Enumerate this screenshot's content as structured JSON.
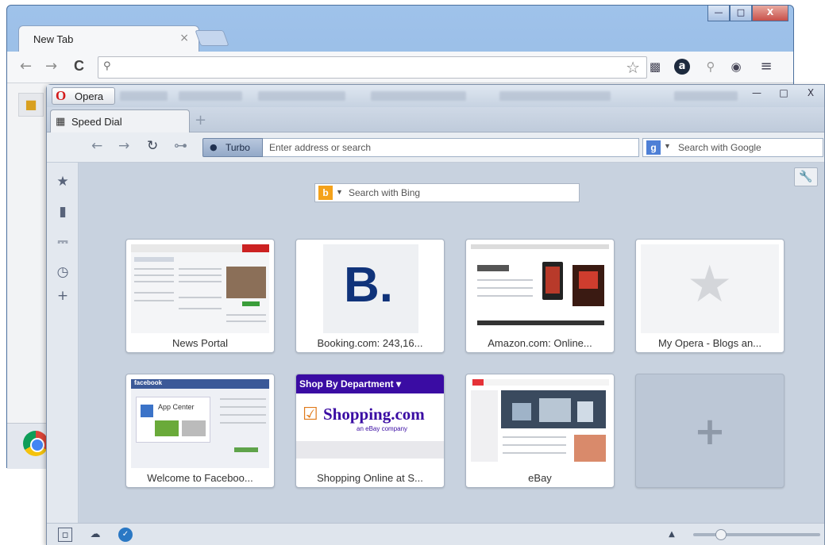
{
  "chrome": {
    "tab_title": "New Tab",
    "tab_close": "×",
    "window_buttons": {
      "minimize": "—",
      "maximize": "□",
      "close": "X"
    },
    "nav": {
      "back": "←",
      "forward": "→",
      "reload": "C"
    },
    "omnibox_placeholder": "",
    "bookmark_star": "☆",
    "extensions": [
      "camera-icon",
      "a-icon",
      "search-icon",
      "eye-icon"
    ],
    "menu_icon": "≡"
  },
  "opera": {
    "menu_label": "Opera",
    "window_buttons": {
      "minimize": "—",
      "maximize": "□",
      "close": "X"
    },
    "tab_title": "Speed Dial",
    "add_tab": "+",
    "turbo_label": "Turbo",
    "address_placeholder": "Enter address or search",
    "search_placeholder": "Search with Google",
    "bing_placeholder": "Search with Bing",
    "sidebar": [
      "bookmarks-star",
      "notes",
      "downloads",
      "history",
      "add-panel"
    ],
    "tiles": [
      {
        "caption": "News Portal",
        "thumb": "news"
      },
      {
        "caption": "Booking.com: 243,16...",
        "thumb": "booking",
        "logo_letter": "B."
      },
      {
        "caption": "Amazon.com: Online...",
        "thumb": "amazon"
      },
      {
        "caption": "My Opera - Blogs an...",
        "thumb": "myopera"
      },
      {
        "caption": "Welcome to Faceboo...",
        "thumb": "facebook",
        "banner": "facebook",
        "app_center": "App Center"
      },
      {
        "caption": "Shopping Online at S...",
        "thumb": "shopping",
        "banner": "Shop By Department ▾",
        "logo": "Shopping.com",
        "sub": "an eBay company"
      },
      {
        "caption": "eBay",
        "thumb": "ebay"
      },
      {
        "caption": "",
        "thumb": "empty"
      }
    ]
  }
}
